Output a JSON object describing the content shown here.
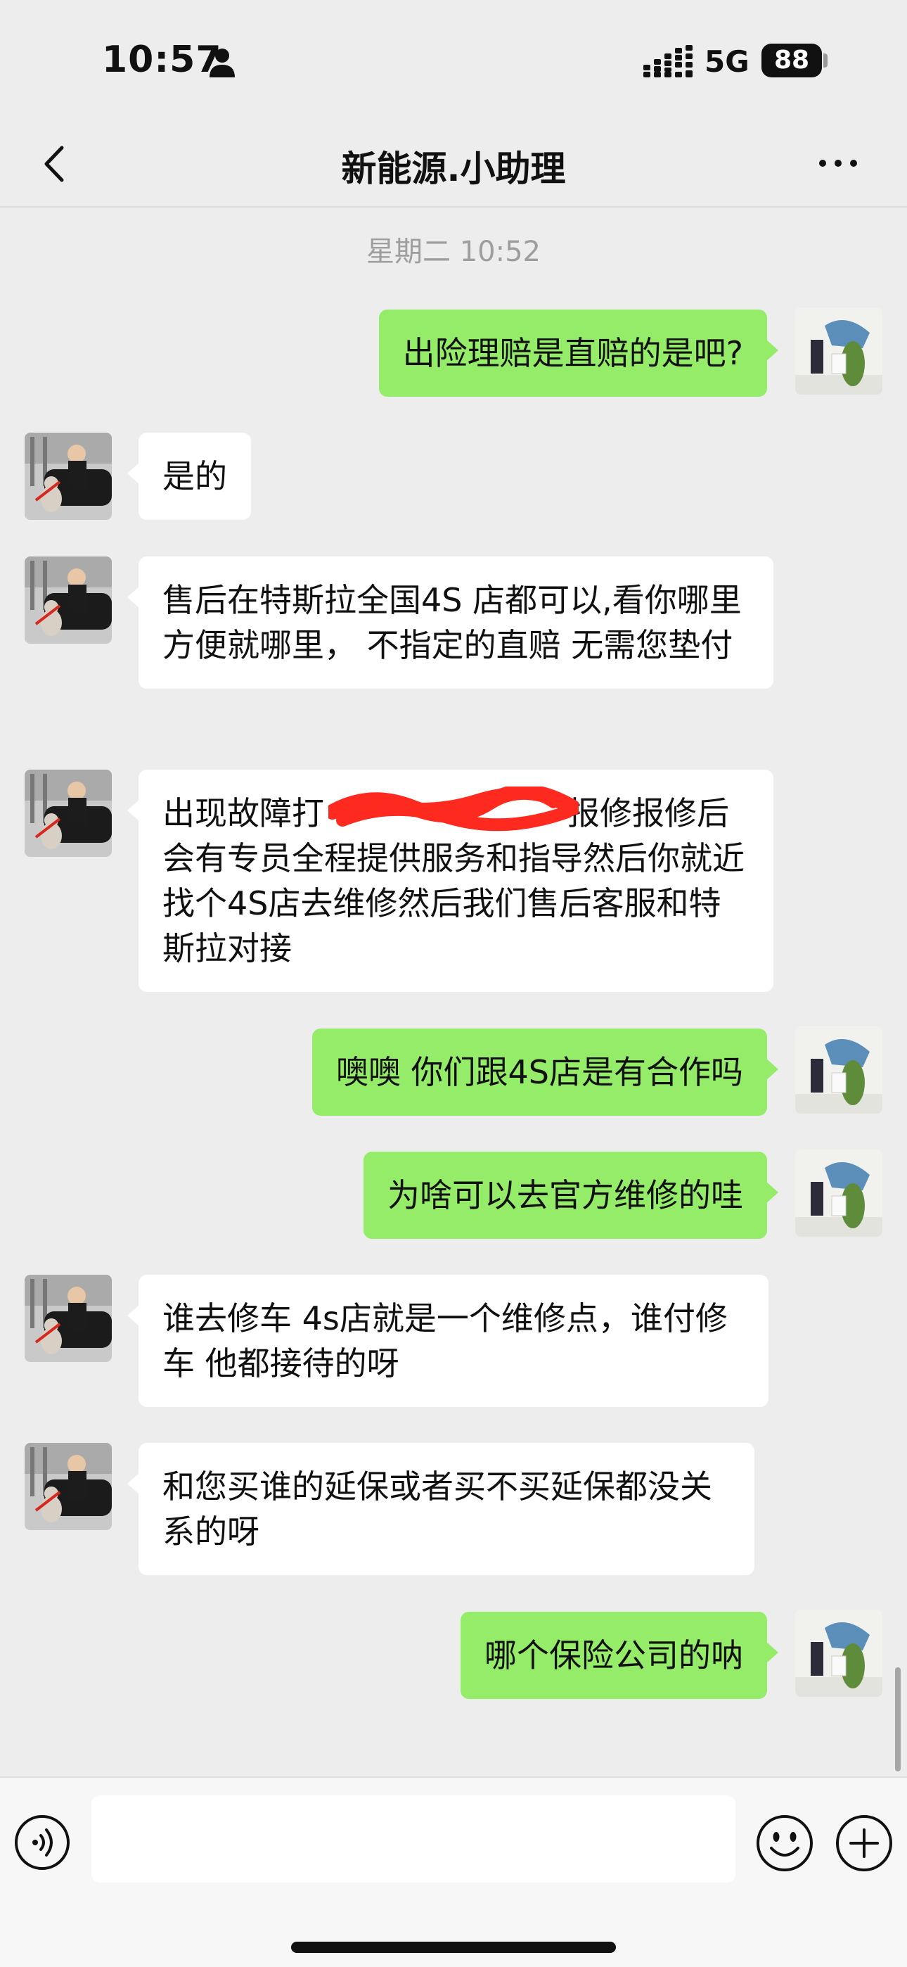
{
  "status_bar": {
    "time": "10:57",
    "network": "5G",
    "battery": "88"
  },
  "nav": {
    "title": "新能源.小助理",
    "back_icon": "chevron-left-icon",
    "more_icon": "more-dots-icon"
  },
  "chat": {
    "timestamp": "星期二 10:52",
    "messages": [
      {
        "sender": "me",
        "text": "出险理赔是直赔的是吧?"
      },
      {
        "sender": "assistant",
        "text": "是的"
      },
      {
        "sender": "assistant",
        "text": "售后在特斯拉全国4S 店都可以,看你哪里方便就哪里， 不指定的直赔 无需您垫付"
      },
      {
        "sender": "assistant",
        "text": "出现故障打 [redacted] 报修报修后会有专员全程提供服务和指导然后你就近找个4S店去维修然后我们售后客服和特斯拉对接",
        "text_before": "出现故障打",
        "text_after": "报修报修后会有专员全程提供服务和指导然后你就近找个4S店去维修然后我们售后客服和特斯拉对接"
      },
      {
        "sender": "me",
        "text": "噢噢 你们跟4S店是有合作吗"
      },
      {
        "sender": "me",
        "text": "为啥可以去官方维修的哇"
      },
      {
        "sender": "assistant",
        "text": "谁去修车 4s店就是一个维修点，谁付修车 他都接待的呀"
      },
      {
        "sender": "assistant",
        "text": "和您买谁的延保或者买不买延保都没关系的呀"
      },
      {
        "sender": "me",
        "text": "哪个保险公司的呐"
      }
    ]
  },
  "input_bar": {
    "message_input_value": "",
    "voice_icon": "voice-icon",
    "emoji_icon": "emoji-icon",
    "plus_icon": "plus-icon"
  },
  "colors": {
    "background": "#ededed",
    "outgoing_bubble": "#95ec69",
    "incoming_bubble": "#ffffff",
    "redaction": "#ff2a1f"
  }
}
